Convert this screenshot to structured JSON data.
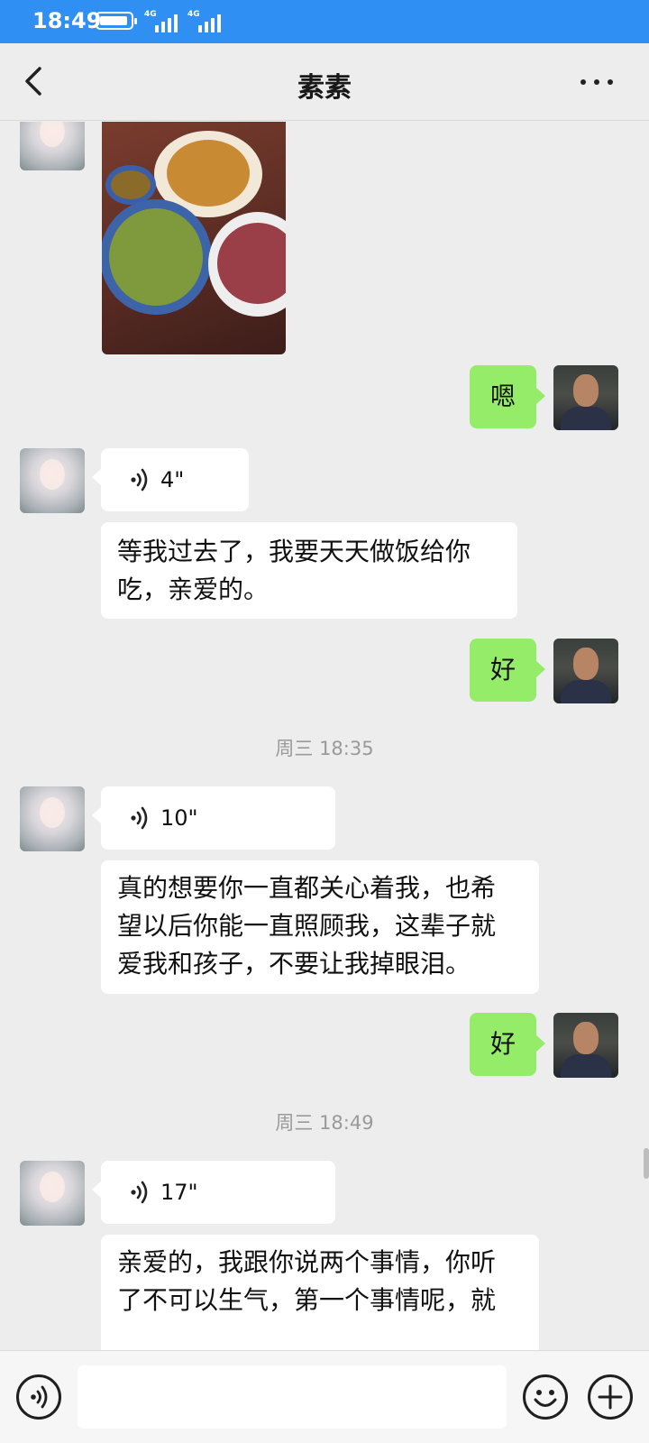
{
  "status_bar": {
    "time": "18:49",
    "network1": "4G",
    "network2": "4G",
    "bg_color": "#2f8ff2"
  },
  "header": {
    "title": "素素",
    "back_icon": "chevron-left-icon",
    "more_icon": "more-horizontal-icon"
  },
  "messages": [
    {
      "type": "image",
      "sender": "contact",
      "content": "food-photo"
    },
    {
      "type": "text",
      "sender": "me",
      "text": "嗯"
    },
    {
      "type": "voice",
      "sender": "contact",
      "duration": "4\""
    },
    {
      "type": "text",
      "sender": "contact",
      "lines": [
        "等我过去了，我要天天做饭给你",
        "吃，亲爱的。"
      ]
    },
    {
      "type": "text",
      "sender": "me",
      "text": "好"
    },
    {
      "type": "time",
      "text": "周三 18:35"
    },
    {
      "type": "voice",
      "sender": "contact",
      "duration": "10\""
    },
    {
      "type": "text",
      "sender": "contact",
      "lines": [
        "真的想要你一直都关心着我，也希",
        "望以后你能一直照顾我，这辈子就",
        "爱我和孩子，不要让我掉眼泪。"
      ]
    },
    {
      "type": "text",
      "sender": "me",
      "text": "好"
    },
    {
      "type": "time",
      "text": "周三 18:49"
    },
    {
      "type": "voice",
      "sender": "contact",
      "duration": "17\""
    },
    {
      "type": "text",
      "sender": "contact",
      "lines": [
        "亲爱的，我跟你说两个事情，你听",
        "了不可以生气，第一个事情呢，就"
      ]
    }
  ],
  "input_bar": {
    "voice_icon": "voice-mode-icon",
    "emoji_icon": "emoji-icon",
    "add_icon": "plus-circle-icon",
    "value": ""
  },
  "colors": {
    "background": "#ededed",
    "my_bubble": "#95ec69",
    "contact_bubble": "#ffffff"
  }
}
